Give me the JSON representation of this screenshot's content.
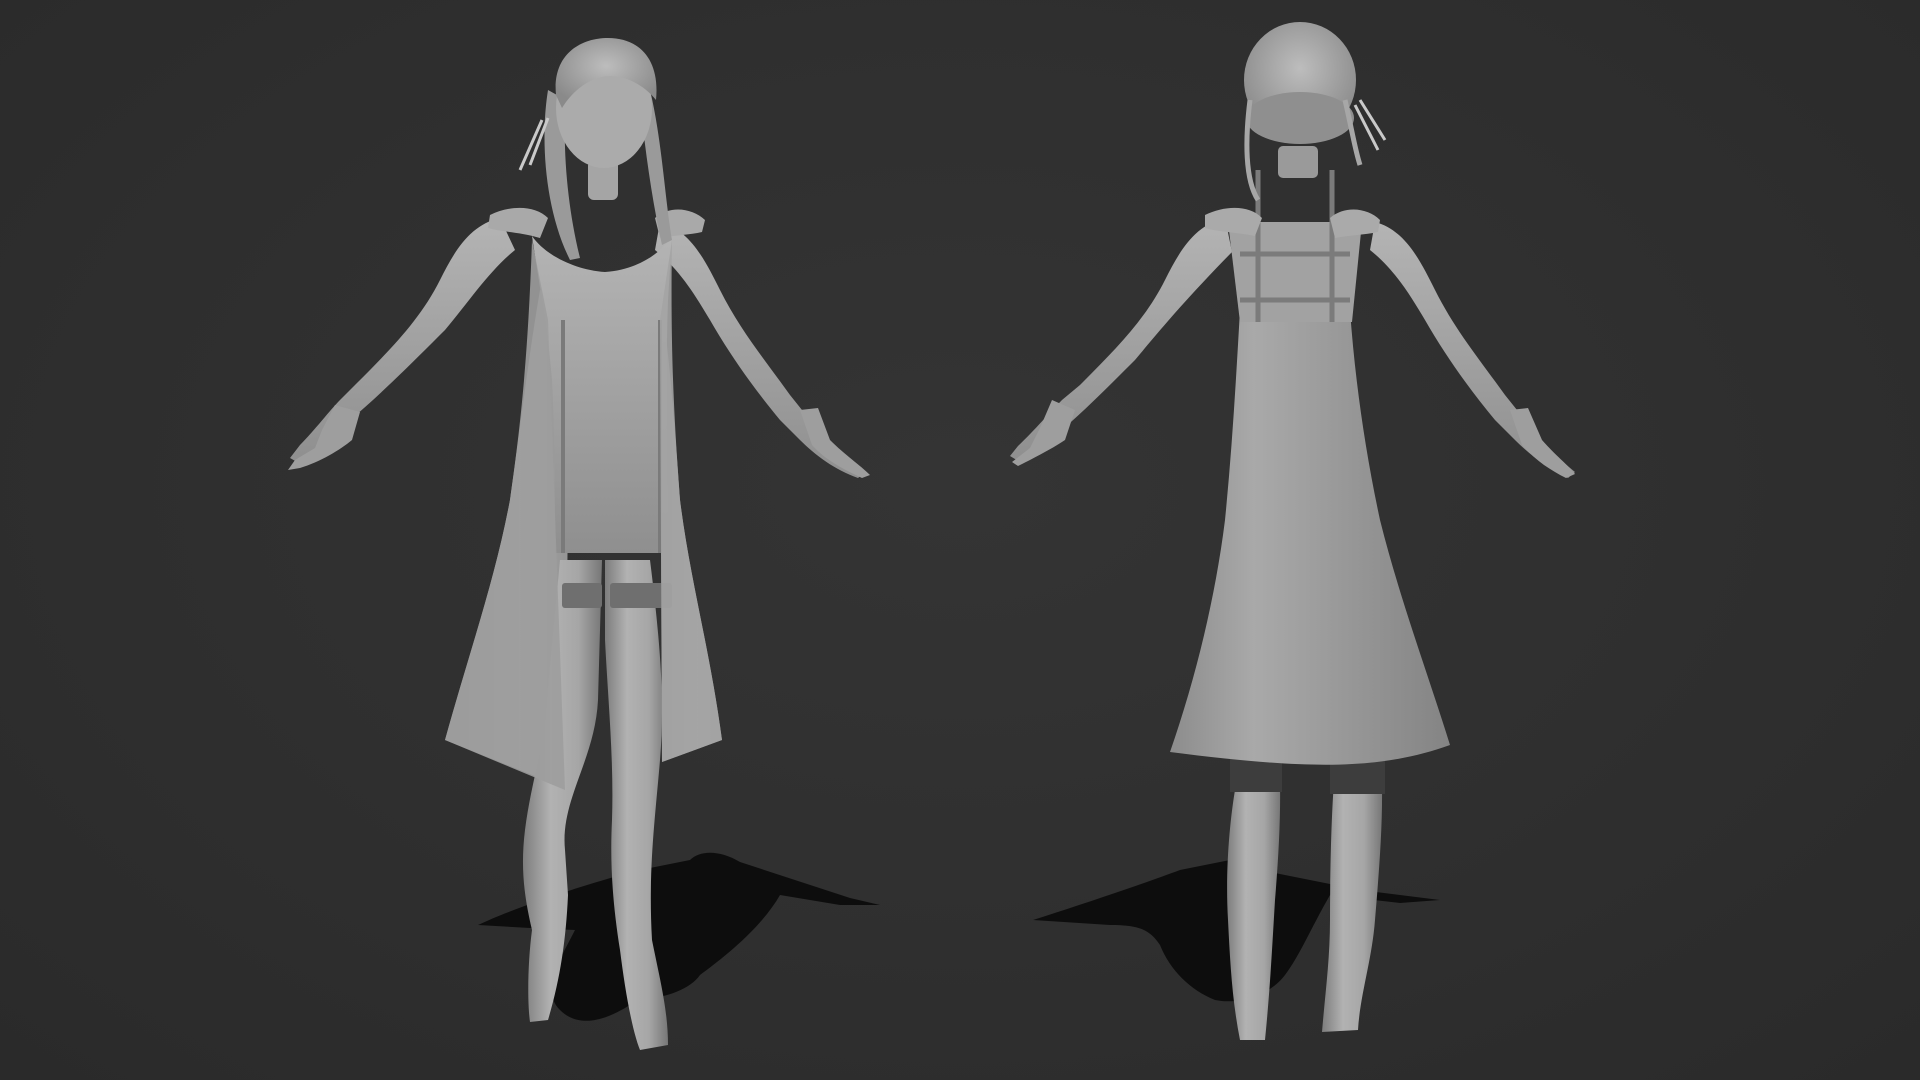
{
  "scene": {
    "background_color": "#2e2e2e",
    "clay_color": "#a3a3a3",
    "shadow_color": "#0b0b0b",
    "views": [
      {
        "id": "front",
        "subject": "female-figure-t-pose-front"
      },
      {
        "id": "back",
        "subject": "female-figure-t-pose-back"
      }
    ]
  }
}
